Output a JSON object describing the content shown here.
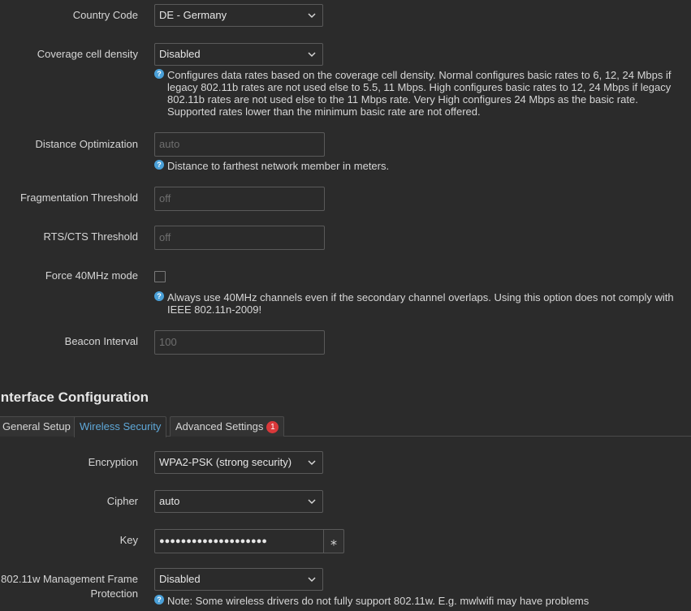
{
  "device": {
    "country_code": {
      "label": "Country Code",
      "value": "DE - Germany"
    },
    "coverage": {
      "label": "Coverage cell density",
      "value": "Disabled",
      "help": "Configures data rates based on the coverage cell density. Normal configures basic rates to 6, 12, 24 Mbps if legacy 802.11b rates are not used else to 5.5, 11 Mbps. High configures basic rates to 12, 24 Mbps if legacy 802.11b rates are not used else to the 11 Mbps rate. Very High configures 24 Mbps as the basic rate. Supported rates lower than the minimum basic rate are not offered."
    },
    "distance": {
      "label": "Distance Optimization",
      "placeholder": "auto",
      "help": "Distance to farthest network member in meters."
    },
    "frag": {
      "label": "Fragmentation Threshold",
      "placeholder": "off"
    },
    "rts": {
      "label": "RTS/CTS Threshold",
      "placeholder": "off"
    },
    "force40": {
      "label": "Force 40MHz mode",
      "help": "Always use 40MHz channels even if the secondary channel overlaps. Using this option does not comply with IEEE 802.11n-2009!"
    },
    "beacon": {
      "label": "Beacon Interval",
      "placeholder": "100"
    }
  },
  "iface": {
    "title": "Interface Configuration",
    "tabs": [
      {
        "label": "General Setup"
      },
      {
        "label": "Wireless Security"
      },
      {
        "label": "Advanced Settings",
        "badge": "1"
      }
    ],
    "encryption": {
      "label": "Encryption",
      "value": "WPA2-PSK (strong security)"
    },
    "cipher": {
      "label": "Cipher",
      "value": "auto"
    },
    "key": {
      "label": "Key",
      "value": "●●●●●●●●●●●●●●●●●●●●",
      "reveal": "⁎"
    },
    "mfp": {
      "label": "802.11w Management Frame Protection",
      "value": "Disabled",
      "help": "Note: Some wireless drivers do not fully support 802.11w. E.g. mwlwifi may have problems"
    }
  },
  "colors": {
    "background": "#2b2b2b",
    "accent": "#5fa8d8",
    "badge": "#d9383a",
    "help_icon": "#4aa0d8"
  },
  "icons": {
    "chevron": "chevron-down-icon",
    "help": "help-circle-icon"
  }
}
